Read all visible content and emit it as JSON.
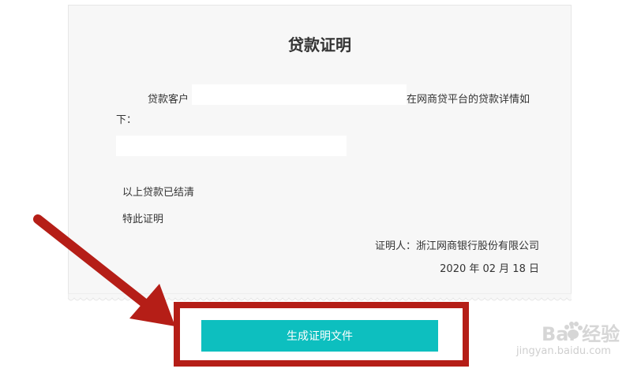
{
  "document": {
    "title": "贷款证明",
    "line1_prefix": "贷款客户",
    "line1_suffix": "在网商贷平台的贷款详情如",
    "line2": "下：",
    "line3": "以上贷款已结清",
    "line4": "特此证明",
    "certifier": "证明人：浙江网商银行股份有限公司",
    "date": "2020 年 02 月 18 日"
  },
  "actions": {
    "generate_label": "生成证明文件"
  },
  "watermark": {
    "brand": "Bai  经验",
    "url": "jingyan.baidu.com"
  },
  "colors": {
    "button": "#0dbfbf",
    "highlight": "#b51e17",
    "card": "#f7f7f7"
  }
}
